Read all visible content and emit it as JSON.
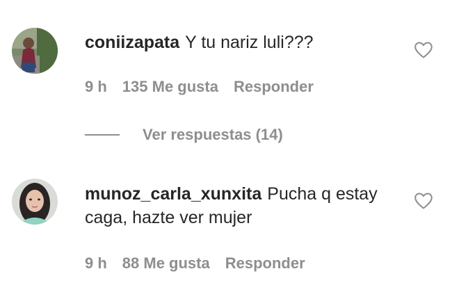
{
  "comments": [
    {
      "username": "coniizapata",
      "text": "Y tu nariz luli???",
      "time": "9 h",
      "likes": "135 Me gusta",
      "reply_label": "Responder",
      "view_replies_label": "Ver respuestas (14)"
    },
    {
      "username": "munoz_carla_xunxita",
      "text": "Pucha q estay caga, hazte ver mujer",
      "time": "9 h",
      "likes": "88 Me gusta",
      "reply_label": "Responder"
    }
  ],
  "colors": {
    "primary_text": "#262626",
    "secondary_text": "#8e8e8e",
    "background": "#ffffff"
  },
  "icons": {
    "like": "heart-outline-icon"
  }
}
